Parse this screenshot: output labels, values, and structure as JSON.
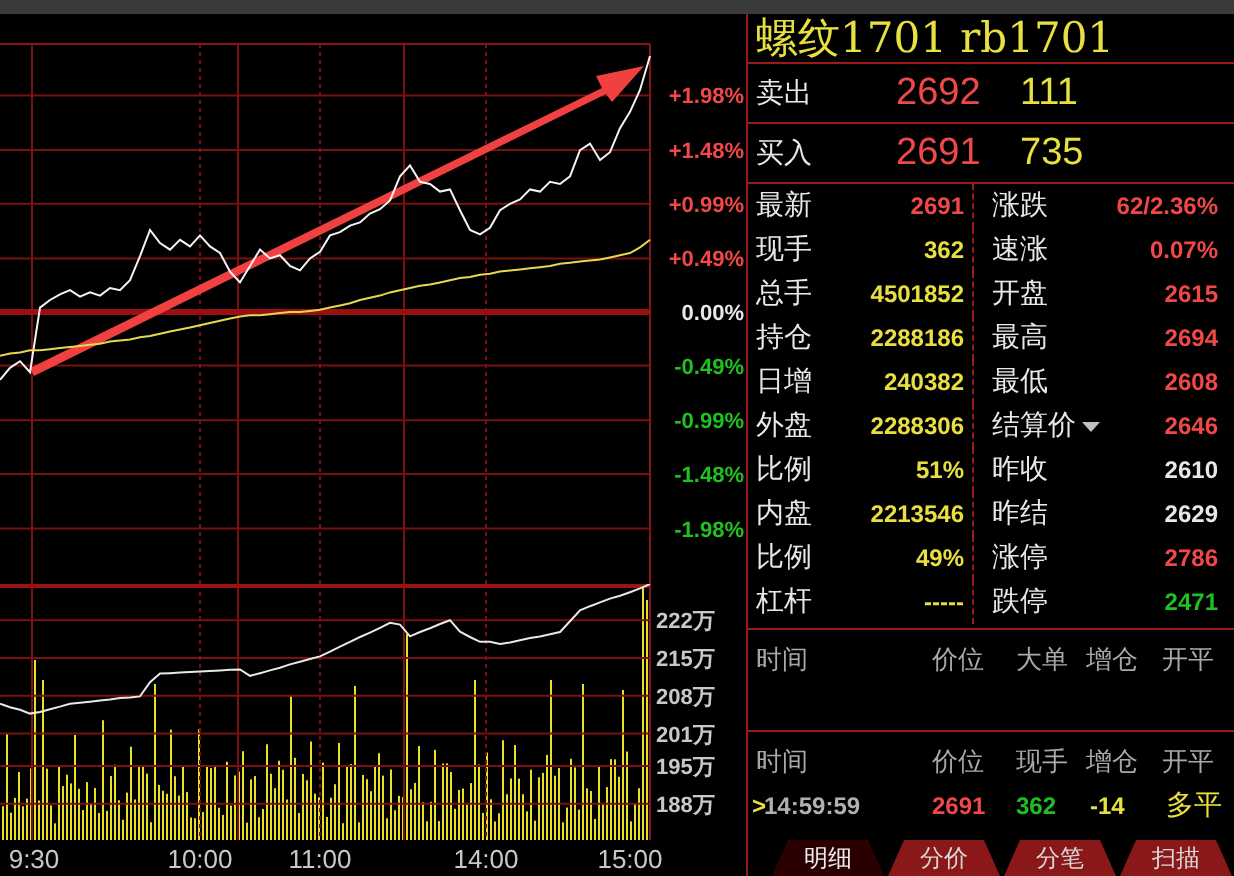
{
  "price_chart": {
    "chart_data": {
      "type": "line",
      "ylim": [
        -2.45,
        2.45
      ],
      "grid": true,
      "ref_lines": [
        {
          "axis": "y",
          "value": 0,
          "color": "#9a1010"
        }
      ],
      "yticks": [
        {
          "value": 1.98,
          "label": "+1.98%"
        },
        {
          "value": 1.48,
          "label": "+1.48%"
        },
        {
          "value": 0.99,
          "label": "+0.99%"
        },
        {
          "value": 0.49,
          "label": "+0.49%"
        },
        {
          "value": 0,
          "label": "0.00%"
        },
        {
          "value": -0.49,
          "label": "-0.49%"
        },
        {
          "value": -0.99,
          "label": "-0.99%"
        },
        {
          "value": -1.48,
          "label": "-1.48%"
        },
        {
          "value": -1.98,
          "label": "-1.98%"
        }
      ],
      "series": [
        {
          "color": "#f4f4f4",
          "values": [
            -0.62,
            -0.51,
            -0.45,
            -0.55,
            0.04,
            0.11,
            0.16,
            0.2,
            0.14,
            0.18,
            0.15,
            0.22,
            0.2,
            0.29,
            0.51,
            0.75,
            0.63,
            0.57,
            0.66,
            0.6,
            0.7,
            0.6,
            0.54,
            0.37,
            0.27,
            0.42,
            0.57,
            0.49,
            0.52,
            0.42,
            0.38,
            0.49,
            0.55,
            0.7,
            0.73,
            0.79,
            0.82,
            0.9,
            0.94,
            1.02,
            1.24,
            1.34,
            1.19,
            1.17,
            1.1,
            1.12,
            0.93,
            0.75,
            0.71,
            0.77,
            0.93,
            0.99,
            1.03,
            1.12,
            1.1,
            1.19,
            1.17,
            1.24,
            1.48,
            1.54,
            1.39,
            1.46,
            1.68,
            1.83,
            2.03,
            2.34
          ]
        },
        {
          "color": "#e8d850",
          "values": [
            -0.4,
            -0.38,
            -0.37,
            -0.35,
            -0.35,
            -0.34,
            -0.33,
            -0.32,
            -0.31,
            -0.3,
            -0.29,
            -0.27,
            -0.26,
            -0.25,
            -0.23,
            -0.22,
            -0.2,
            -0.18,
            -0.16,
            -0.14,
            -0.12,
            -0.1,
            -0.08,
            -0.06,
            -0.04,
            -0.03,
            -0.03,
            -0.02,
            -0.01,
            0,
            0,
            0.01,
            0.02,
            0.04,
            0.06,
            0.08,
            0.11,
            0.13,
            0.15,
            0.18,
            0.2,
            0.22,
            0.24,
            0.25,
            0.27,
            0.29,
            0.31,
            0.32,
            0.34,
            0.35,
            0.37,
            0.38,
            0.39,
            0.4,
            0.41,
            0.42,
            0.44,
            0.45,
            0.46,
            0.47,
            0.48,
            0.5,
            0.52,
            0.54,
            0.59,
            0.66
          ]
        }
      ]
    }
  },
  "volume_chart": {
    "chart_data": {
      "type": "line",
      "ylim": [
        181.3,
        228.7
      ],
      "grid": true,
      "yticks": [
        {
          "value": 222,
          "label": "222万"
        },
        {
          "value": 215,
          "label": "215万"
        },
        {
          "value": 208,
          "label": "208万"
        },
        {
          "value": 201,
          "label": "201万"
        },
        {
          "value": 195,
          "label": "195万"
        },
        {
          "value": 188,
          "label": "188万"
        }
      ],
      "series": [
        {
          "color": "#e8e8e8",
          "values": [
            206.5,
            205.9,
            205.4,
            204.7,
            205,
            205.5,
            206,
            206.5,
            206.7,
            206.9,
            207.1,
            207.3,
            207.6,
            207.7,
            207.9,
            210.5,
            212.1,
            212.2,
            212.3,
            212.4,
            212.5,
            212.6,
            212.7,
            212.8,
            212.9,
            211.7,
            212.2,
            212.7,
            213.2,
            213.8,
            214.3,
            214.8,
            215.3,
            216.2,
            217.1,
            218,
            218.9,
            219.7,
            220.6,
            221.5,
            221.2,
            219,
            219.8,
            220.5,
            221.3,
            222,
            219.9,
            218.9,
            218,
            218,
            217.6,
            217.9,
            218.3,
            218.7,
            219,
            219.4,
            219.8,
            221.8,
            223.8,
            224.6,
            225.3,
            226,
            226.5,
            227.2,
            227.9,
            228.7
          ]
        }
      ]
    }
  },
  "time_axis": [
    "9:30",
    "10:00",
    "11:00",
    "14:00",
    "15:00"
  ],
  "quote": {
    "title": "螺纹1701 rb1701",
    "orders": [
      {
        "label": "卖出",
        "price": "2692",
        "volume": "111"
      },
      {
        "label": "买入",
        "price": "2691",
        "volume": "735"
      }
    ]
  },
  "stats": [
    {
      "left": {
        "label": "最新",
        "value": "2691",
        "color": "#f04848"
      },
      "right": {
        "label": "涨跌",
        "value": "62/2.36%",
        "color": "#f04848",
        "menu": false
      }
    },
    {
      "left": {
        "label": "现手",
        "value": "362",
        "color": "#e8e040"
      },
      "right": {
        "label": "速涨",
        "value": "0.07%",
        "color": "#f04848",
        "menu": false
      }
    },
    {
      "left": {
        "label": "总手",
        "value": "4501852",
        "color": "#e8e040"
      },
      "right": {
        "label": "开盘",
        "value": "2615",
        "color": "#f04848",
        "menu": false
      }
    },
    {
      "left": {
        "label": "持仓",
        "value": "2288186",
        "color": "#e8e040"
      },
      "right": {
        "label": "最高",
        "value": "2694",
        "color": "#f04848",
        "menu": false
      }
    },
    {
      "left": {
        "label": "日增",
        "value": "240382",
        "color": "#e8e040"
      },
      "right": {
        "label": "最低",
        "value": "2608",
        "color": "#f04848",
        "menu": false
      }
    },
    {
      "left": {
        "label": "外盘",
        "value": "2288306",
        "color": "#e8e040"
      },
      "right": {
        "label": "结算价",
        "value": "2646",
        "color": "#f04848",
        "menu": true
      }
    },
    {
      "left": {
        "label": "比例",
        "value": "51%",
        "color": "#e8e040"
      },
      "right": {
        "label": "昨收",
        "value": "2610",
        "color": "#e8e8e8",
        "menu": false
      }
    },
    {
      "left": {
        "label": "内盘",
        "value": "2213546",
        "color": "#e8e040"
      },
      "right": {
        "label": "昨结",
        "value": "2629",
        "color": "#e8e8e8",
        "menu": false
      }
    },
    {
      "left": {
        "label": "比例",
        "value": "49%",
        "color": "#e8e040"
      },
      "right": {
        "label": "涨停",
        "value": "2786",
        "color": "#f04848",
        "menu": false
      }
    },
    {
      "left": {
        "label": "杠杆",
        "value": "-----",
        "color": "#e8e040"
      },
      "right": {
        "label": "跌停",
        "value": "2471",
        "color": "#20c020",
        "menu": false
      }
    }
  ],
  "big_orders": {
    "columns": [
      "时间",
      "价位",
      "大单",
      "增仓",
      "开平"
    ]
  },
  "ticks": {
    "columns": [
      "时间",
      "价位",
      "现手",
      "增仓",
      "开平"
    ],
    "rows": [
      {
        "marker": ">",
        "cells": [
          {
            "text": "14:59:59",
            "color": "#b0b0b0"
          },
          {
            "text": "2691",
            "color": "#f04848"
          },
          {
            "text": "362",
            "color": "#20c020"
          },
          {
            "text": "-14",
            "color": "#e8e040"
          },
          {
            "text": "多平",
            "color": "#e8e040"
          }
        ]
      }
    ]
  },
  "tabs": [
    {
      "label": "明细",
      "selected": true
    },
    {
      "label": "分价",
      "selected": false
    },
    {
      "label": "分笔",
      "selected": false
    },
    {
      "label": "扫描",
      "selected": false
    }
  ]
}
